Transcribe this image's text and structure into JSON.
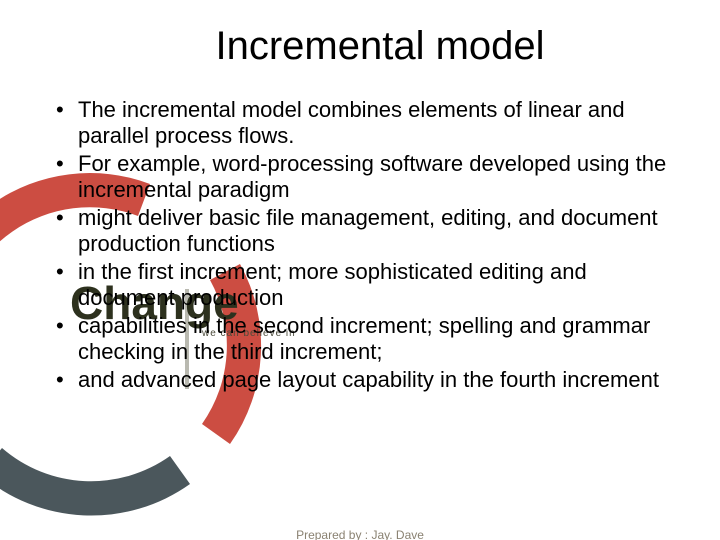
{
  "title": "Incremental model",
  "bullets": [
    "The incremental model combines elements of linear and parallel process flows.",
    "For example, word-processing software developed using the incremental paradigm",
    "might deliver basic file management, editing, and document production functions",
    "in the first increment; more sophisticated editing and document production",
    "capabilities in the second increment; spelling and grammar checking in the third increment;",
    "and advanced page layout capability in the fourth increment"
  ],
  "footer": "Prepared by : Jay. Dave",
  "watermark": {
    "main": "Change",
    "sub": "we can believe in"
  },
  "colors": {
    "ring_red": "#c73a2e",
    "ring_dark": "#2c3a3f"
  }
}
